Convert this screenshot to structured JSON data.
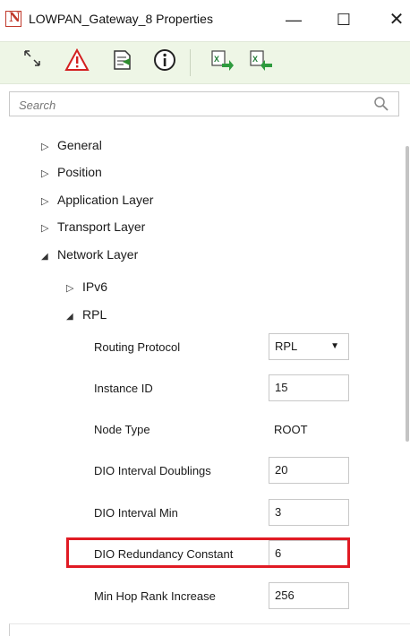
{
  "window": {
    "title": "LOWPAN_Gateway_8 Properties",
    "minimize": "—",
    "maximize": "☐",
    "close": "✕"
  },
  "toolbar": {
    "buttons": [
      {
        "icon": "expand-arrows-icon",
        "tooltip": ""
      },
      {
        "icon": "warning-icon",
        "tooltip": ""
      },
      {
        "icon": "document-icon",
        "tooltip": ""
      },
      {
        "icon": "info-icon",
        "tooltip": ""
      },
      {
        "icon": "excel-export-icon",
        "tooltip": ""
      },
      {
        "icon": "excel-import-icon",
        "tooltip": ""
      }
    ]
  },
  "search": {
    "placeholder": "Search",
    "value": ""
  },
  "tree": {
    "general": "General",
    "position": "Position",
    "application_layer": "Application Layer",
    "transport_layer": "Transport Layer",
    "network_layer": "Network Layer",
    "ipv6": "IPv6",
    "rpl": "RPL"
  },
  "properties": {
    "routing_protocol": {
      "label": "Routing Protocol",
      "value": "RPL"
    },
    "instance_id": {
      "label": "Instance ID",
      "value": "15"
    },
    "node_type": {
      "label": "Node Type",
      "value": "ROOT"
    },
    "dio_interval_doublings": {
      "label": "DIO Interval Doublings",
      "value": "20"
    },
    "dio_interval_min": {
      "label": "DIO Interval Min",
      "value": "3"
    },
    "dio_redundancy_constant": {
      "label": "DIO Redundancy Constant",
      "value": "6"
    },
    "min_hop_rank_increase": {
      "label": "Min Hop Rank Increase",
      "value": "256"
    }
  },
  "colors": {
    "toolbar_bg": "#eef6e6",
    "highlight": "#e01b24",
    "accent_green": "#2e8b2e"
  }
}
